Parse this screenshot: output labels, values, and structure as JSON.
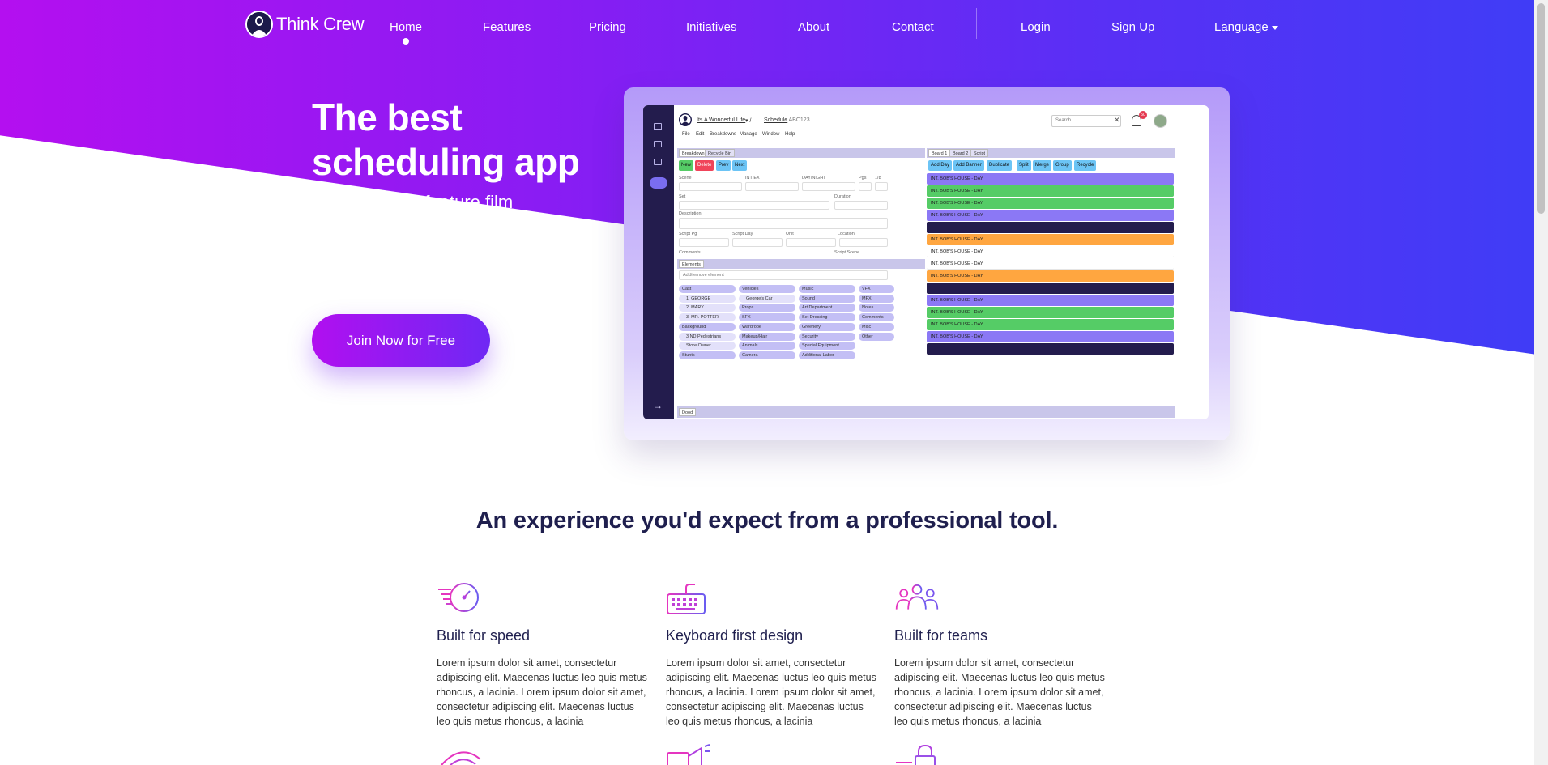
{
  "brand": {
    "name": "Think Crew"
  },
  "nav": {
    "items": [
      {
        "label": "Home",
        "active": true
      },
      {
        "label": "Features"
      },
      {
        "label": "Pricing"
      },
      {
        "label": "Initiatives"
      },
      {
        "label": "About"
      },
      {
        "label": "Contact"
      }
    ],
    "login": "Login",
    "signup": "Sign Up",
    "language": "Language"
  },
  "hero": {
    "title": "The best scheduling app",
    "subtitle": "for series and feature film production",
    "cta": "Join Now for Free"
  },
  "app_preview": {
    "project": "Its A Wonderful Life",
    "schedule": "Schedule",
    "code": "ABC123",
    "search_placeholder": "Search",
    "notifications": "50",
    "menu": [
      "File",
      "Edit",
      "Breakdowns",
      "Manage",
      "Window",
      "Help"
    ],
    "left_tabs": [
      "Breakdown",
      "Recycle Bin"
    ],
    "right_tabs": [
      "Board 1",
      "Board 2",
      "Script"
    ],
    "left_buttons": [
      "New",
      "Delete",
      "Prev",
      "Next"
    ],
    "right_buttons": [
      "Add Day",
      "Add Banner",
      "Duplicate",
      "Split",
      "Merge",
      "Group",
      "Recycle"
    ],
    "form_labels": [
      "Scene",
      "INT/EXT",
      "DAY/NIGHT",
      "Pgs",
      "1/8",
      "Set",
      "Duration",
      "Description",
      "Script Pg",
      "Script Day",
      "Unit",
      "Location",
      "Comments",
      "Script Scene"
    ],
    "elements_tab": "Elements",
    "elements_placeholder": "Add/remove element",
    "elements": [
      [
        "Cast",
        "1. GEORGE",
        "2. MARY",
        "3. MR. POTTER",
        "Background",
        "3 ND Pedestrians",
        "Store Owner",
        "Stunts"
      ],
      [
        "Vehicles",
        "George's Car",
        "Props",
        "SFX",
        "Wardrobe",
        "Makeup/Hair",
        "Animals",
        "Camera"
      ],
      [
        "Music",
        "Sound",
        "Art Department",
        "Set Dressing",
        "Greenery",
        "Security",
        "Special Equipment",
        "Additional Labor"
      ],
      [
        "VFX",
        "MFX",
        "Notes",
        "Comments",
        "Misc",
        "Other"
      ]
    ],
    "strip_label": "INT. BOB'S HOUSE - DAY",
    "footer_tab": "Dood"
  },
  "features_section": {
    "title": "An experience you'd expect from a professional tool.",
    "items": [
      {
        "title": "Built for speed",
        "icon": "speedometer-icon",
        "text": "Lorem ipsum dolor sit amet, consectetur adipiscing elit. Maecenas luctus leo quis metus rhoncus, a lacinia. Lorem ipsum dolor sit amet, consectetur adipiscing elit. Maecenas luctus leo quis metus rhoncus, a lacinia"
      },
      {
        "title": "Keyboard first design",
        "icon": "keyboard-icon",
        "text": "Lorem ipsum dolor sit amet, consectetur adipiscing elit. Maecenas luctus leo quis metus rhoncus, a lacinia. Lorem ipsum dolor sit amet, consectetur adipiscing elit. Maecenas luctus leo quis metus rhoncus, a lacinia"
      },
      {
        "title": "Built for teams",
        "icon": "team-icon",
        "text": "Lorem ipsum dolor sit amet, consectetur adipiscing elit. Maecenas luctus leo quis metus rhoncus, a lacinia. Lorem ipsum dolor sit amet, consectetur adipiscing elit. Maecenas luctus leo quis metus rhoncus, a lacinia"
      }
    ]
  },
  "colors": {
    "gradient_start": "#b40ff0",
    "gradient_end": "#3f3df6",
    "heading": "#1f1f4e",
    "strip_purple": "#8b78f5",
    "strip_green": "#55cc66",
    "strip_orange": "#ffa640",
    "strip_navy": "#231c4d"
  }
}
